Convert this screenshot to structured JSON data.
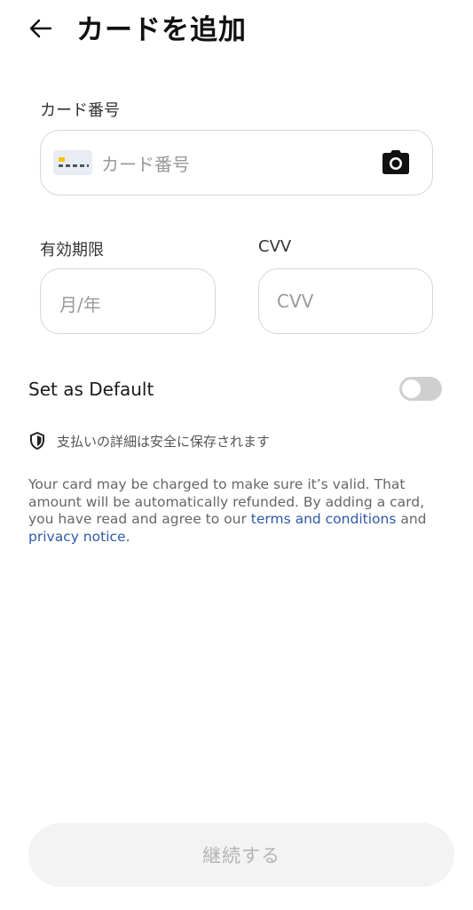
{
  "header": {
    "title": "カードを追加",
    "back_icon": "arrow-left-icon"
  },
  "card_number": {
    "label": "カード番号",
    "placeholder": "カード番号",
    "card_icon": "credit-card-icon",
    "camera_icon": "camera-icon"
  },
  "expiry": {
    "label": "有効期限",
    "placeholder": "月/年"
  },
  "cvv": {
    "label": "CVV",
    "placeholder": "CVV"
  },
  "default_setting": {
    "label": "Set as Default",
    "enabled": false
  },
  "secure_notice": {
    "icon": "shield-icon",
    "text": "支払いの詳細は安全に保存されます"
  },
  "legal": {
    "text_before": "Your card may be charged to make sure it’s valid. That amount will be automatically refunded. By adding a card, you have read and agree to our ",
    "terms_link": "terms and conditions",
    "text_middle": " and ",
    "privacy_link": "privacy notice",
    "text_after": "."
  },
  "footer": {
    "continue_label": "継続する"
  },
  "colors": {
    "link": "#2f5aa8",
    "toggle_off": "#cfcfcf",
    "button_disabled_bg": "#f3f3f3",
    "button_disabled_text": "#b3b3b3",
    "card_chip": "#f5c400"
  }
}
